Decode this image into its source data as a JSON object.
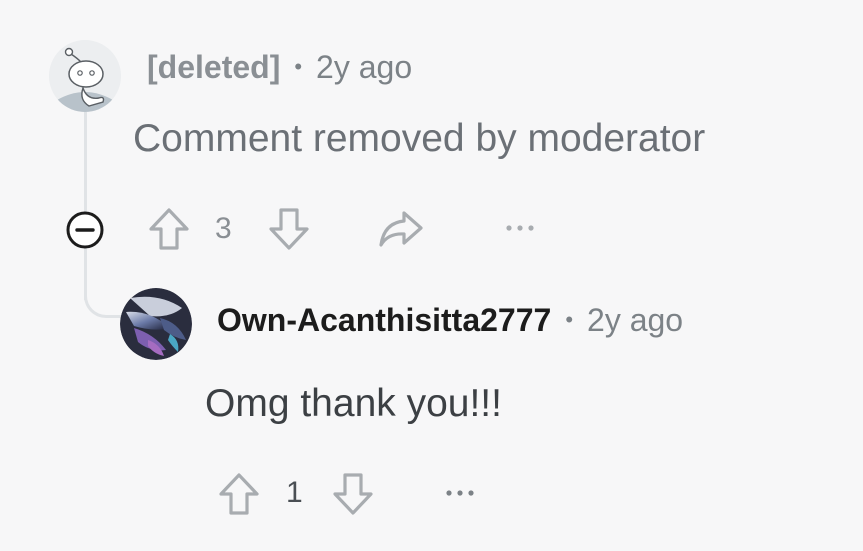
{
  "comments": [
    {
      "author": "[deleted]",
      "separator": "•",
      "timestamp": "2y ago",
      "body": "Comment removed by moderator",
      "votes": "3",
      "actions": {
        "collapse_icon": "collapse-minus-icon",
        "upvote_icon": "upvote-arrow-icon",
        "downvote_icon": "downvote-arrow-icon",
        "share_icon": "share-arrow-icon",
        "more_icon": "more-horizontal-icon"
      }
    },
    {
      "author": "Own-Acanthisitta2777",
      "separator": "•",
      "timestamp": "2y ago",
      "body": "Omg thank you!!!",
      "votes": "1",
      "actions": {
        "upvote_icon": "upvote-arrow-icon",
        "downvote_icon": "downvote-arrow-icon",
        "more_icon": "more-horizontal-icon"
      }
    }
  ],
  "colors": {
    "background": "#f7f7f8",
    "thread_line": "#e0e3e6",
    "author_deleted": "#8a8f94",
    "author": "#1c1c1c",
    "body": "#4a4f54",
    "muted": "#7c8287",
    "icon": "#a8acb0"
  }
}
